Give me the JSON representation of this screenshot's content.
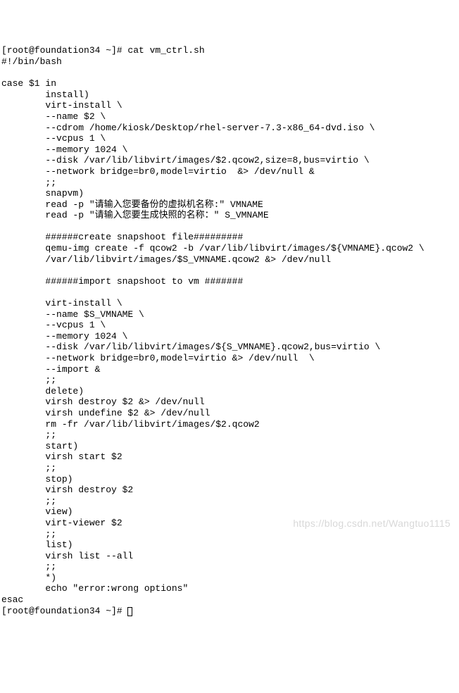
{
  "prompt_line": "[root@foundation34 ~]# cat vm_ctrl.sh",
  "script_lines": [
    "#!/bin/bash",
    "",
    "case $1 in",
    "        install)",
    "        virt-install \\",
    "        --name $2 \\",
    "        --cdrom /home/kiosk/Desktop/rhel-server-7.3-x86_64-dvd.iso \\",
    "        --vcpus 1 \\",
    "        --memory 1024 \\",
    "        --disk /var/lib/libvirt/images/$2.qcow2,size=8,bus=virtio \\",
    "        --network bridge=br0,model=virtio  &> /dev/null &",
    "        ;;",
    "        snapvm)",
    "        read -p \"请输入您要备份的虚拟机名称:\" VMNAME",
    "        read -p \"请输入您要生成快照的名称：\" S_VMNAME",
    "",
    "        ######create snapshoot file#########",
    "        qemu-img create -f qcow2 -b /var/lib/libvirt/images/${VMNAME}.qcow2 \\",
    "        /var/lib/libvirt/images/$S_VMNAME.qcow2 &> /dev/null",
    "",
    "        ######import snapshoot to vm #######",
    "",
    "        virt-install \\",
    "        --name $S_VMNAME \\",
    "        --vcpus 1 \\",
    "        --memory 1024 \\",
    "        --disk /var/lib/libvirt/images/${S_VMNAME}.qcow2,bus=virtio \\",
    "        --network bridge=br0,model=virtio &> /dev/null  \\",
    "        --import &",
    "        ;;",
    "        delete)",
    "        virsh destroy $2 &> /dev/null",
    "        virsh undefine $2 &> /dev/null",
    "        rm -fr /var/lib/libvirt/images/$2.qcow2",
    "        ;;",
    "        start)",
    "        virsh start $2",
    "        ;;",
    "        stop)",
    "        virsh destroy $2",
    "        ;;",
    "        view)",
    "        virt-viewer $2",
    "        ;;",
    "        list)",
    "        virsh list --all",
    "        ;;",
    "        *)",
    "        echo \"error:wrong options\"",
    "esac"
  ],
  "bottom_prompt": "[root@foundation34 ~]# ",
  "watermark": "https://blog.csdn.net/Wangtuo1115"
}
